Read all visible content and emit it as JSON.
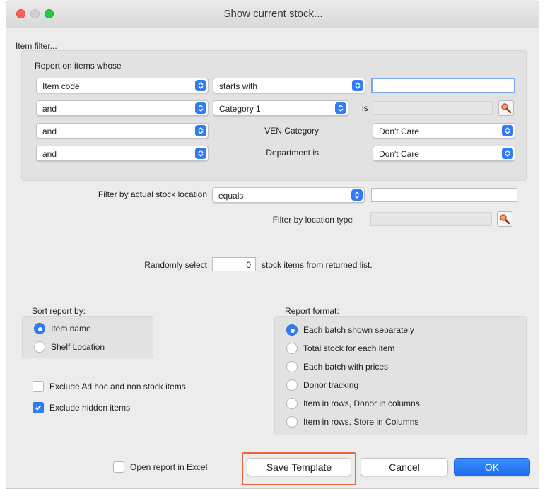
{
  "window": {
    "title": "Show current stock..."
  },
  "item_filter": {
    "title": "Item filter...",
    "report_on_label": "Report on items whose",
    "rows": [
      {
        "field": "Item code",
        "operator": "starts with",
        "value": ""
      },
      {
        "conjunction": "and",
        "field": "Category 1",
        "is_label": "is",
        "value": ""
      },
      {
        "conjunction": "and",
        "label": "VEN Category",
        "value": "Don't Care"
      },
      {
        "conjunction": "and",
        "label": "Department is",
        "value": "Don't Care"
      }
    ]
  },
  "location_filter": {
    "label": "Filter by actual stock location",
    "operator": "equals",
    "value": "",
    "type_label": "Filter by location type",
    "type_value": ""
  },
  "random_select": {
    "prefix": "Randomly select",
    "count": "0",
    "suffix": "stock items from returned list."
  },
  "sort": {
    "title": "Sort report by:",
    "options": [
      {
        "label": "Item name",
        "selected": true
      },
      {
        "label": "Shelf Location",
        "selected": false
      }
    ]
  },
  "report_format": {
    "title": "Report format:",
    "options": [
      {
        "label": "Each batch shown separately",
        "selected": true
      },
      {
        "label": "Total stock for each item",
        "selected": false
      },
      {
        "label": "Each batch with prices",
        "selected": false
      },
      {
        "label": "Donor tracking",
        "selected": false
      },
      {
        "label": "Item in rows, Donor in columns",
        "selected": false
      },
      {
        "label": "Item in rows, Store in Columns",
        "selected": false
      }
    ]
  },
  "options": {
    "exclude_adhoc": {
      "label": "Exclude Ad hoc and non stock items",
      "checked": false
    },
    "exclude_hidden": {
      "label": "Exclude hidden items",
      "checked": true
    },
    "open_excel": {
      "label": "Open report in Excel",
      "checked": false
    }
  },
  "buttons": {
    "save_template": "Save Template",
    "cancel": "Cancel",
    "ok": "OK"
  },
  "colors": {
    "accent": "#2f7cf6",
    "highlight": "#e4673f"
  }
}
